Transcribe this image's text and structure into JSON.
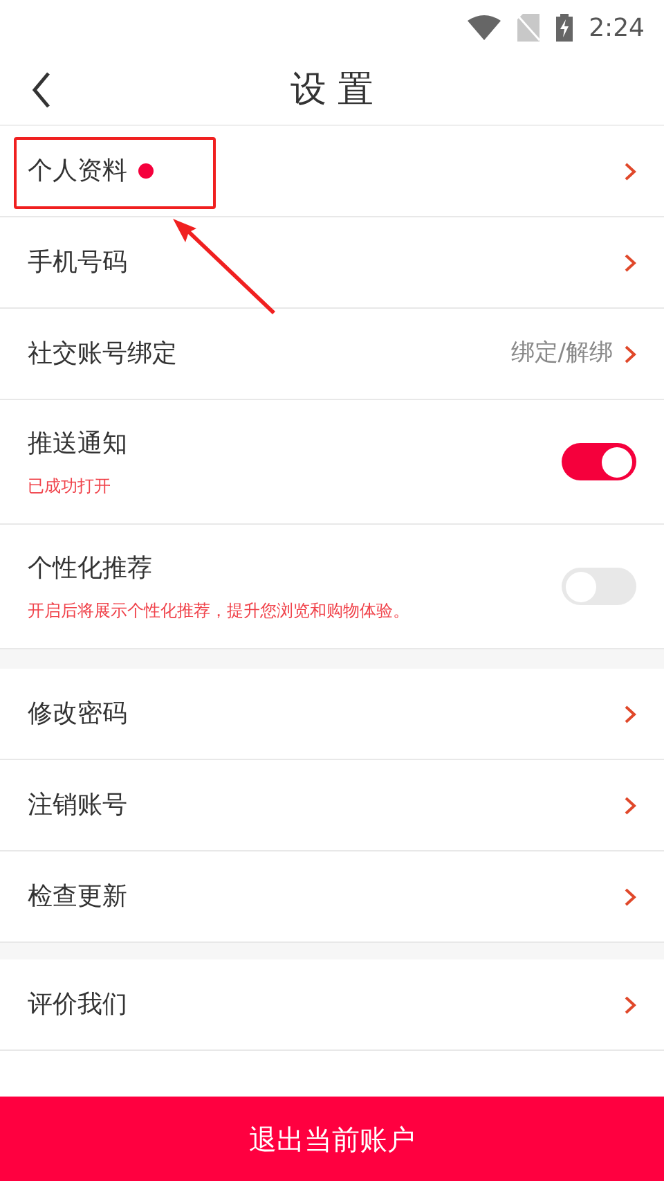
{
  "status_bar": {
    "time": "2:24"
  },
  "header": {
    "title": "设 置"
  },
  "sections": [
    {
      "items": [
        {
          "kind": "link",
          "label": "个人资料",
          "dot": true
        },
        {
          "kind": "link",
          "label": "手机号码",
          "dot": false
        },
        {
          "kind": "link",
          "label": "社交账号绑定",
          "dot": false,
          "value": "绑定/解绑"
        },
        {
          "kind": "toggle",
          "label": "推送通知",
          "subtitle": "已成功打开",
          "on": true
        },
        {
          "kind": "toggle",
          "label": "个性化推荐",
          "subtitle": "开启后将展示个性化推荐，提升您浏览和购物体验。",
          "on": false
        }
      ]
    },
    {
      "items": [
        {
          "kind": "link",
          "label": "修改密码",
          "dot": false
        },
        {
          "kind": "link",
          "label": "注销账号",
          "dot": false
        },
        {
          "kind": "link",
          "label": "检查更新",
          "dot": false
        }
      ]
    },
    {
      "items": [
        {
          "kind": "link",
          "label": "评价我们",
          "dot": false
        }
      ]
    }
  ],
  "logout_button": {
    "label": "退出当前账户"
  }
}
